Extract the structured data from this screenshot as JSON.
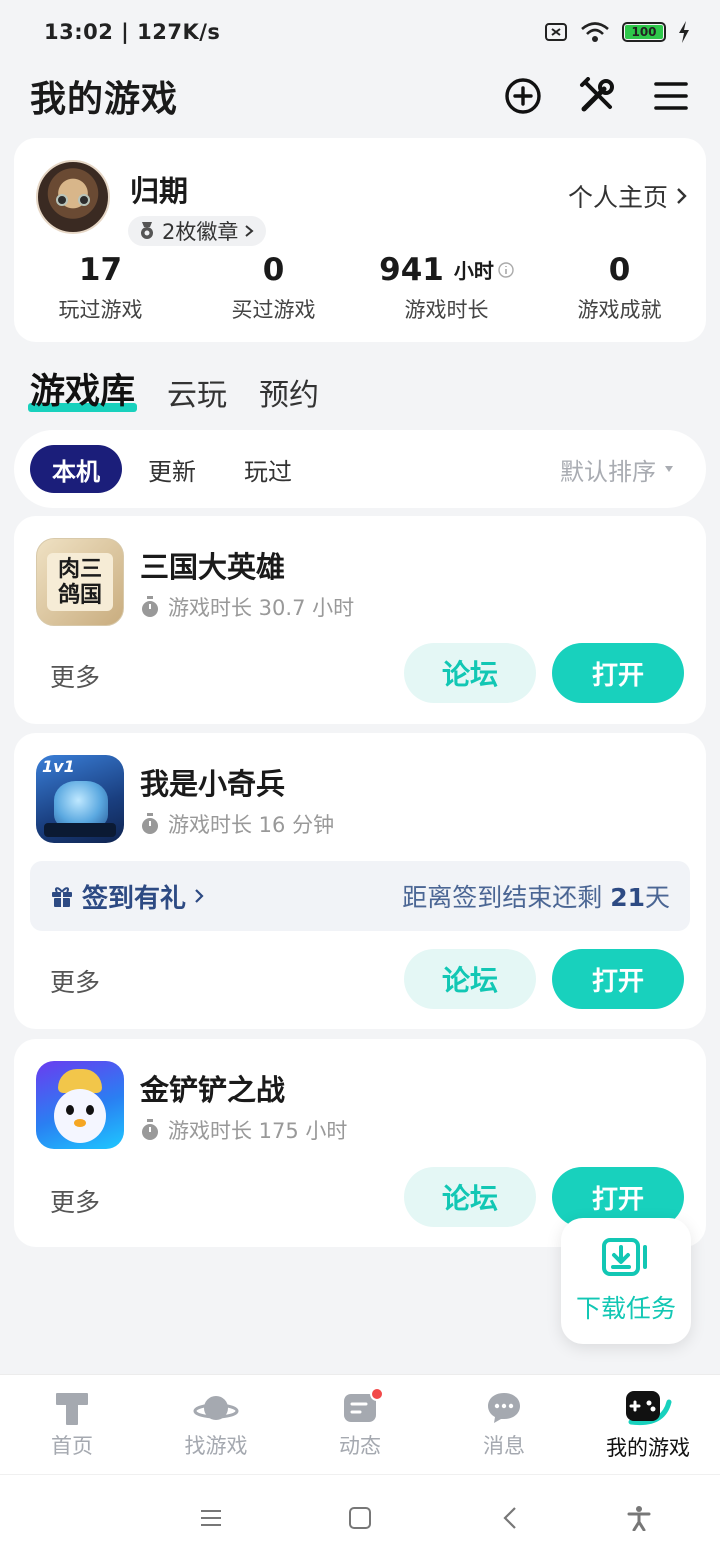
{
  "status_bar": {
    "time": "13:02 | 127K/s",
    "battery": "100"
  },
  "header": {
    "title": "我的游戏"
  },
  "profile": {
    "username": "归期",
    "badges": "2枚徽章",
    "homepage_link": "个人主页",
    "stats": [
      {
        "value": "17",
        "label": "玩过游戏"
      },
      {
        "value": "0",
        "label": "买过游戏"
      },
      {
        "value": "941",
        "unit": "小时",
        "label": "游戏时长"
      },
      {
        "value": "0",
        "label": "游戏成就"
      }
    ]
  },
  "library_tabs": [
    "游戏库",
    "云玩",
    "预约"
  ],
  "filters": {
    "chips": [
      "本机",
      "更新",
      "玩过"
    ],
    "sort": "默认排序"
  },
  "games": [
    {
      "name": "三国大英雄",
      "playtime": "游戏时长 30.7 小时",
      "icon_text": [
        "肉三",
        "鸽国"
      ],
      "more": "更多",
      "forum": "论坛",
      "open": "打开"
    },
    {
      "name": "我是小奇兵",
      "playtime": "游戏时长 16 分钟",
      "icon_text": [
        "1v1"
      ],
      "more": "更多",
      "forum": "论坛",
      "open": "打开",
      "checkin": {
        "label": "签到有礼",
        "remaining_prefix": "距离签到结束还剩 ",
        "remaining_days": "21",
        "remaining_suffix": "天"
      }
    },
    {
      "name": "金铲铲之战",
      "playtime": "游戏时长 175 小时",
      "more": "更多",
      "forum": "论坛",
      "open": "打开"
    }
  ],
  "download_task": "下载任务",
  "bottom_nav": [
    "首页",
    "找游戏",
    "动态",
    "消息",
    "我的游戏"
  ],
  "colors": {
    "accent": "#18d1bd",
    "chip_active": "#1b1e7a",
    "notification": "#f24949"
  }
}
